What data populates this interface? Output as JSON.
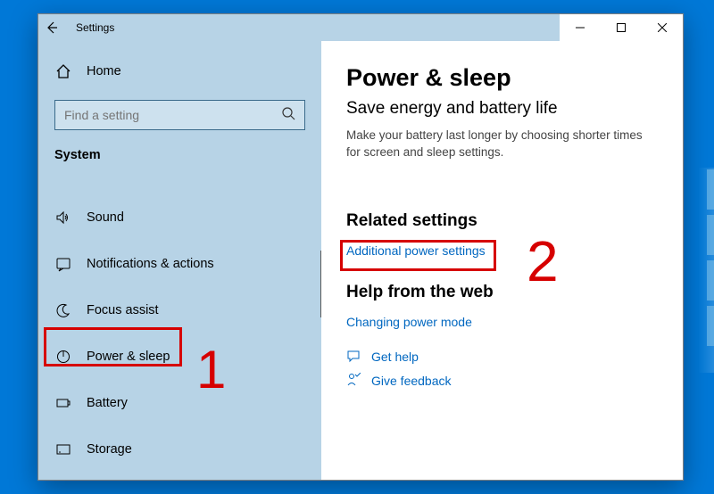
{
  "window_title": "Settings",
  "home_label": "Home",
  "search_placeholder": "Find a setting",
  "section_label": "System",
  "nav": {
    "sound": "Sound",
    "notifications": "Notifications & actions",
    "focus": "Focus assist",
    "power": "Power & sleep",
    "battery": "Battery",
    "storage": "Storage"
  },
  "main": {
    "title": "Power & sleep",
    "subhead": "Save energy and battery life",
    "body": "Make your battery last longer by choosing shorter times for screen and sleep settings.",
    "related_heading": "Related settings",
    "related_link": "Additional power settings",
    "help_heading": "Help from the web",
    "help_link": "Changing power mode",
    "get_help": "Get help",
    "feedback": "Give feedback"
  },
  "annotations": {
    "one": "1",
    "two": "2"
  }
}
